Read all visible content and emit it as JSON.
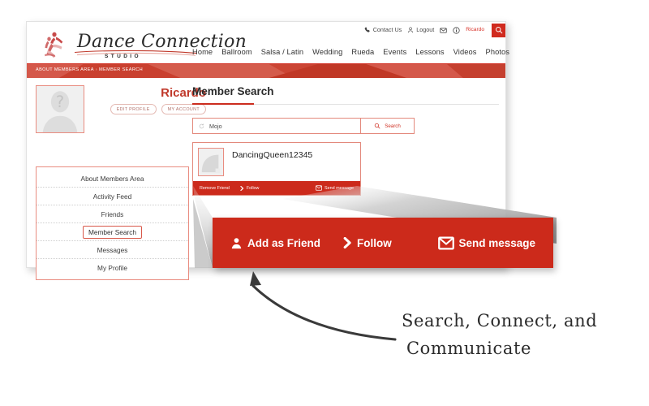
{
  "utility_bar": {
    "items": [
      {
        "icon": "phone-icon",
        "label": "Contact Us"
      },
      {
        "icon": "user-icon",
        "label": "Logout"
      },
      {
        "icon": "envelope-icon",
        "label": ""
      },
      {
        "icon": "info-icon",
        "label": ""
      }
    ],
    "username": "Ricardo",
    "search_icon": "search-icon"
  },
  "logo": {
    "script_text": "Dance Connection",
    "sub_text": "STUDIO",
    "mark": "dancers-icon"
  },
  "main_nav": {
    "items": [
      {
        "label": "Home"
      },
      {
        "label": "Ballroom"
      },
      {
        "label": "Salsa / Latin"
      },
      {
        "label": "Wedding"
      },
      {
        "label": "Rueda"
      },
      {
        "label": "Events"
      },
      {
        "label": "Lessons"
      },
      {
        "label": "Videos"
      },
      {
        "label": "Photos"
      }
    ]
  },
  "breadcrumb": {
    "parent": "ABOUT MEMBERS AREA",
    "separator": "›",
    "current": "MEMBER SEARCH"
  },
  "profile": {
    "avatar_icon": "user-placeholder-icon",
    "name": "Ricardo",
    "edit_profile_label": "EDIT PROFILE",
    "my_account_label": "MY ACCOUNT"
  },
  "sidebar": {
    "items": [
      {
        "label": "About Members Area",
        "active": false
      },
      {
        "label": "Activity Feed",
        "active": false
      },
      {
        "label": "Friends",
        "active": false
      },
      {
        "label": "Member Search",
        "active": true
      },
      {
        "label": "Messages",
        "active": false
      },
      {
        "label": "My Profile",
        "active": false
      }
    ]
  },
  "main": {
    "title": "Member Search",
    "search": {
      "value": "Mojo",
      "placeholder": "Mojo",
      "refresh_icon": "refresh-icon",
      "button_label": "Search",
      "button_icon": "search-icon"
    },
    "result": {
      "thumbnail_icon": "image-placeholder-icon",
      "username": "DancingQueen12345",
      "actions": {
        "friend_label": "Remove Friend",
        "follow_label": "Follow",
        "follow_icon": "chevron-right-icon",
        "message_label": "Send message",
        "message_icon": "envelope-icon"
      }
    }
  },
  "callout": {
    "friend_label": "Add as Friend",
    "friend_icon": "user-add-icon",
    "follow_label": "Follow",
    "follow_icon": "chevron-right-icon",
    "message_label": "Send message",
    "message_icon": "envelope-icon"
  },
  "annotation": {
    "line1": "Search, Connect, and",
    "line2": "Communicate",
    "arrow_icon": "curved-arrow-icon"
  },
  "colors": {
    "brand_red": "#cc2a1b",
    "band_red": "#cf4030",
    "accent_red": "#d9332a",
    "border_pink": "#e98c80"
  }
}
